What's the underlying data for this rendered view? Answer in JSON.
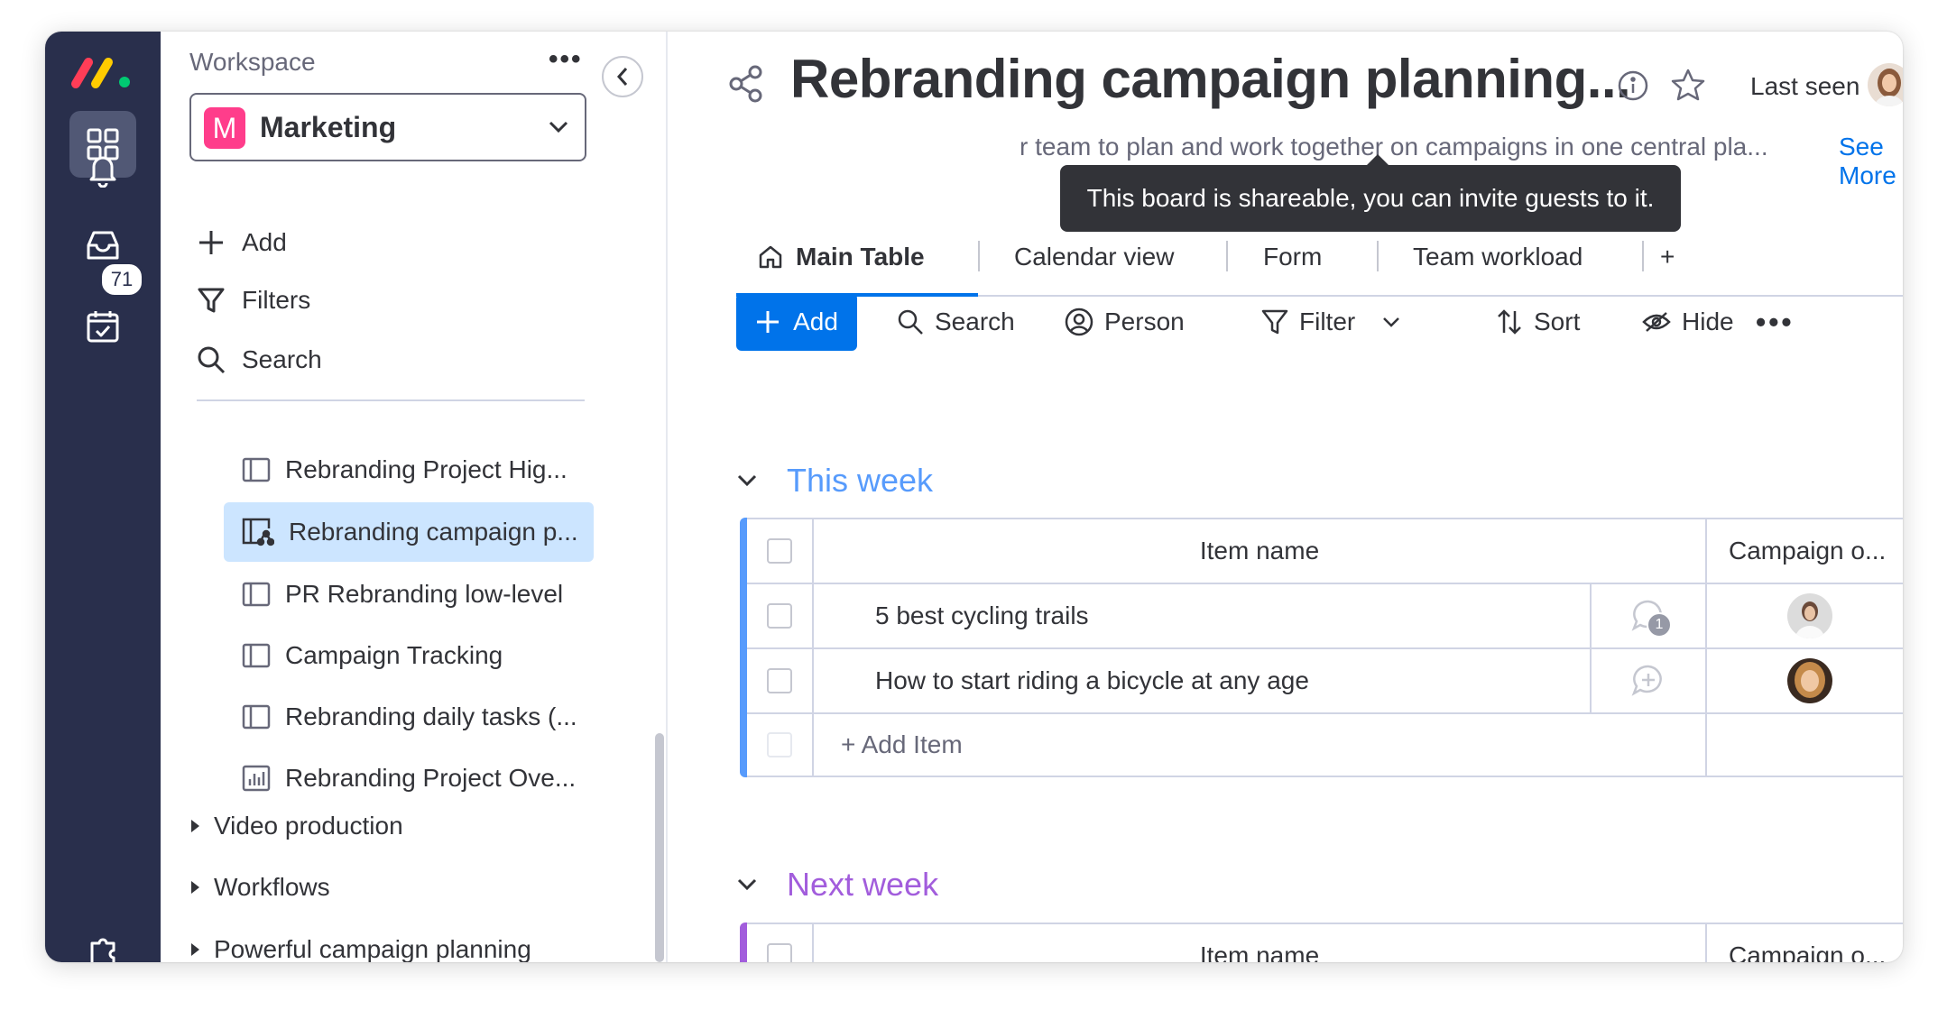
{
  "rail": {
    "notification_count": "71"
  },
  "sidebar": {
    "workspace_label": "Workspace",
    "workspace_initial": "M",
    "workspace_name": "Marketing",
    "actions": [
      "Add",
      "Filters",
      "Search"
    ],
    "boards": [
      {
        "label": "Rebranding Project Hig...",
        "icon": "board-icon",
        "selected": false
      },
      {
        "label": "Rebranding campaign p...",
        "icon": "shareable-board-icon",
        "selected": true
      },
      {
        "label": "PR Rebranding low-level",
        "icon": "board-icon",
        "selected": false
      },
      {
        "label": "Campaign Tracking",
        "icon": "board-icon",
        "selected": false
      },
      {
        "label": "Rebranding daily tasks (...",
        "icon": "board-icon",
        "selected": false
      },
      {
        "label": "Rebranding Project Ove...",
        "icon": "dashboard-icon",
        "selected": false
      }
    ],
    "folders": [
      "Video production",
      "Workflows",
      "Powerful campaign planning"
    ]
  },
  "header": {
    "title": "Rebranding campaign planning...",
    "last_seen": "Last seen",
    "description": "r team to plan and work together on campaigns in one central pla...",
    "see_more": "See More",
    "tooltip": "This board is shareable, you can invite guests to it."
  },
  "tabs": [
    "Main Table",
    "Calendar view",
    "Form",
    "Team workload",
    "+"
  ],
  "toolbar": {
    "add": "Add",
    "search": "Search",
    "person": "Person",
    "filter": "Filter",
    "sort": "Sort",
    "hide": "Hide"
  },
  "groups": [
    {
      "title": "This week",
      "color": "#579bfc",
      "columns": {
        "name": "Item name",
        "campaign": "Campaign o..."
      },
      "items": [
        {
          "name": "5 best cycling trails",
          "updates": "1"
        },
        {
          "name": "How to start riding a bicycle at any age",
          "updates": ""
        }
      ],
      "add_item": "+ Add Item"
    },
    {
      "title": "Next week",
      "color": "#a25ddc",
      "columns": {
        "name": "Item name",
        "campaign": "Campaign o..."
      }
    }
  ]
}
